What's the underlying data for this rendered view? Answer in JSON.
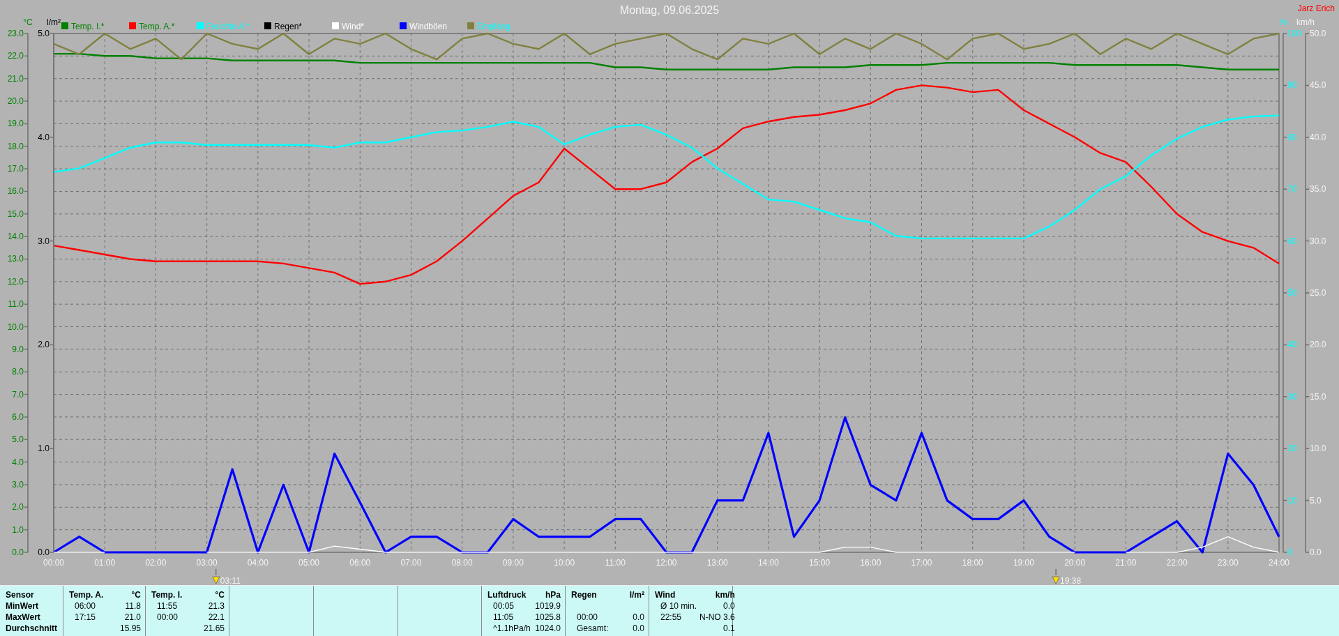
{
  "title": "Montag, 09.06.2025",
  "author": "Jarz Erich",
  "chart": {
    "axis_units": [
      "°C",
      "l/m²",
      "%",
      "km/h"
    ],
    "rain_ticks": [
      "5.0",
      "4.0",
      "3.0",
      "2.0",
      "1.0",
      "0.0"
    ],
    "chart_data": {
      "type": "line",
      "grid": true,
      "legend": true,
      "xlim": [
        0,
        24
      ],
      "ylim": [
        0,
        23
      ],
      "y2lim": [
        0,
        100
      ],
      "y3lim": [
        0,
        50
      ],
      "y2ticks": [
        {
          "value": 0,
          "label": "0"
        },
        {
          "value": 10,
          "label": "10"
        },
        {
          "value": 20,
          "label": "20"
        },
        {
          "value": 30,
          "label": "30"
        },
        {
          "value": 40,
          "label": "40"
        },
        {
          "value": 50,
          "label": "50"
        },
        {
          "value": 60,
          "label": "60"
        },
        {
          "value": 70,
          "label": "70"
        },
        {
          "value": 80,
          "label": "80"
        },
        {
          "value": 90,
          "label": "90"
        },
        {
          "value": 100,
          "label": "100"
        }
      ],
      "y3ticks": [
        {
          "value": 0,
          "label": "0.0"
        },
        {
          "value": 5,
          "label": "5.0"
        },
        {
          "value": 10,
          "label": "10.0"
        },
        {
          "value": 15,
          "label": "15.0"
        },
        {
          "value": 20,
          "label": "20.0"
        },
        {
          "value": 25,
          "label": "25.0"
        },
        {
          "value": 30,
          "label": "30.0"
        },
        {
          "value": 35,
          "label": "35.0"
        },
        {
          "value": 40,
          "label": "40.0"
        },
        {
          "value": 45,
          "label": "45.0"
        },
        {
          "value": 50,
          "label": "50.0"
        }
      ],
      "x": [
        0,
        0.5,
        1,
        1.5,
        2,
        2.5,
        3,
        3.5,
        4,
        4.5,
        5,
        5.5,
        6,
        6.5,
        7,
        7.5,
        8,
        8.5,
        9,
        9.5,
        10,
        10.5,
        11,
        11.5,
        12,
        12.5,
        13,
        13.5,
        14,
        14.5,
        15,
        15.5,
        16,
        16.5,
        17,
        17.5,
        18,
        18.5,
        19,
        19.5,
        20,
        20.5,
        21,
        21.5,
        22,
        22.5,
        23,
        23.5,
        24
      ],
      "xticks": [
        {
          "value": 0,
          "label": "00:00"
        },
        {
          "value": 1,
          "label": "01:00"
        },
        {
          "value": 2,
          "label": "02:00"
        },
        {
          "value": 3,
          "label": "03:00"
        },
        {
          "value": 4,
          "label": "04:00"
        },
        {
          "value": 5,
          "label": "05:00"
        },
        {
          "value": 6,
          "label": "06:00"
        },
        {
          "value": 7,
          "label": "07:00"
        },
        {
          "value": 8,
          "label": "08:00"
        },
        {
          "value": 9,
          "label": "09:00"
        },
        {
          "value": 10,
          "label": "10:00"
        },
        {
          "value": 11,
          "label": "11:00"
        },
        {
          "value": 12,
          "label": "12:00"
        },
        {
          "value": 13,
          "label": "13:00"
        },
        {
          "value": 14,
          "label": "14:00"
        },
        {
          "value": 15,
          "label": "15:00"
        },
        {
          "value": 16,
          "label": "16:00"
        },
        {
          "value": 17,
          "label": "17:00"
        },
        {
          "value": 18,
          "label": "18:00"
        },
        {
          "value": 19,
          "label": "19:00"
        },
        {
          "value": 20,
          "label": "20:00"
        },
        {
          "value": 21,
          "label": "21:00"
        },
        {
          "value": 22,
          "label": "22:00"
        },
        {
          "value": 23,
          "label": "23:00"
        },
        {
          "value": 24,
          "label": "24:00"
        }
      ],
      "yticks": [
        {
          "value": 0,
          "label": "0.0"
        },
        {
          "value": 1,
          "label": "1.0"
        },
        {
          "value": 2,
          "label": "2.0"
        },
        {
          "value": 3,
          "label": "3.0"
        },
        {
          "value": 4,
          "label": "4.0"
        },
        {
          "value": 5,
          "label": "5.0"
        },
        {
          "value": 6,
          "label": "6.0"
        },
        {
          "value": 7,
          "label": "7.0"
        },
        {
          "value": 8,
          "label": "8.0"
        },
        {
          "value": 9,
          "label": "9.0"
        },
        {
          "value": 10,
          "label": "10.0"
        },
        {
          "value": 11,
          "label": "11.0"
        },
        {
          "value": 12,
          "label": "12.0"
        },
        {
          "value": 13,
          "label": "13.0"
        },
        {
          "value": 14,
          "label": "14.0"
        },
        {
          "value": 15,
          "label": "15.0"
        },
        {
          "value": 16,
          "label": "16.0"
        },
        {
          "value": 17,
          "label": "17.0"
        },
        {
          "value": 18,
          "label": "18.0"
        },
        {
          "value": 19,
          "label": "19.0"
        },
        {
          "value": 20,
          "label": "20.0"
        },
        {
          "value": 21,
          "label": "21.0"
        },
        {
          "value": 22,
          "label": "22.0"
        },
        {
          "value": 23,
          "label": "23.0"
        }
      ],
      "series": [
        {
          "name": "Temp. I.*",
          "color": "#008000",
          "values": [
            22.1,
            22.1,
            22.0,
            22.0,
            21.9,
            21.9,
            21.9,
            21.8,
            21.8,
            21.8,
            21.8,
            21.8,
            21.7,
            21.7,
            21.7,
            21.7,
            21.7,
            21.7,
            21.7,
            21.7,
            21.7,
            21.7,
            21.5,
            21.5,
            21.4,
            21.4,
            21.4,
            21.4,
            21.4,
            21.5,
            21.5,
            21.5,
            21.6,
            21.6,
            21.6,
            21.7,
            21.7,
            21.7,
            21.7,
            21.7,
            21.6,
            21.6,
            21.6,
            21.6,
            21.6,
            21.5,
            21.4,
            21.4,
            21.4
          ]
        },
        {
          "name": "Temp. A.*",
          "color": "#ff0000",
          "values": [
            13.6,
            13.4,
            13.2,
            13.0,
            12.9,
            12.9,
            12.9,
            12.9,
            12.9,
            12.8,
            12.6,
            12.4,
            11.9,
            12.0,
            12.3,
            12.9,
            13.8,
            14.8,
            15.8,
            16.4,
            17.9,
            17.0,
            16.1,
            16.1,
            16.4,
            17.3,
            17.9,
            18.8,
            19.1,
            19.3,
            19.4,
            19.6,
            19.9,
            20.5,
            20.7,
            20.6,
            20.4,
            20.5,
            19.6,
            19.0,
            18.4,
            17.7,
            17.3,
            16.2,
            15.0,
            14.2,
            13.8,
            13.5,
            12.8
          ]
        },
        {
          "name": "Feuchte A.*",
          "color": "#00ffff",
          "axis": "y2",
          "values": [
            73.3,
            74,
            76,
            78,
            79,
            79,
            78.5,
            78.5,
            78.5,
            78.5,
            78.5,
            78,
            79,
            79,
            80,
            81,
            81.3,
            82,
            83,
            82,
            78.6,
            80.5,
            82,
            82.4,
            80.5,
            78,
            74,
            71,
            68,
            67.6,
            66,
            64.4,
            63.6,
            61,
            60.5,
            60.5,
            60.5,
            60.5,
            60.5,
            62.8,
            66,
            70,
            72.5,
            76.5,
            79.7,
            82,
            83.4,
            84,
            84.2
          ]
        },
        {
          "name": "Regen*",
          "color": "#000000",
          "values": [
            null,
            null,
            null,
            null,
            null,
            null,
            null,
            null,
            null,
            null,
            null,
            null,
            null,
            null,
            null,
            null,
            null,
            null,
            null,
            null,
            null,
            null,
            null,
            null,
            null,
            null,
            null,
            null,
            null,
            null,
            null,
            null,
            null,
            null,
            null,
            null,
            null,
            null,
            null,
            null,
            null,
            null,
            null,
            null,
            null,
            null,
            null,
            null,
            null
          ]
        },
        {
          "name": "Wind*",
          "color": "#ffffff",
          "axis": "y3",
          "values": [
            0,
            0,
            0,
            null,
            null,
            null,
            0,
            0,
            0,
            0,
            0,
            0.6,
            0.3,
            0,
            0,
            0,
            0,
            0,
            0,
            0,
            0,
            0,
            0,
            0,
            0,
            0,
            0,
            0,
            0,
            0,
            0,
            0.5,
            0.5,
            0,
            0,
            0,
            0,
            0,
            0,
            0,
            0,
            null,
            0,
            0,
            0,
            0.5,
            1.5,
            0.5,
            0
          ]
        },
        {
          "name": "Windböen",
          "color": "#0000ff",
          "axis": "y3",
          "values": [
            0,
            1.5,
            0,
            0,
            0,
            0,
            0,
            8,
            0,
            6.5,
            0,
            9.5,
            4.8,
            0,
            1.5,
            1.5,
            0,
            0,
            3.2,
            1.5,
            1.5,
            1.5,
            3.2,
            3.2,
            0,
            0,
            5,
            5,
            11.5,
            1.5,
            5,
            13,
            6.5,
            5,
            11.5,
            5,
            3.2,
            3.2,
            5,
            1.5,
            0,
            0,
            0,
            1.5,
            3,
            0,
            9.5,
            6.5,
            1.5
          ]
        },
        {
          "name": "Empfang",
          "color": "#808040",
          "axis": "y2",
          "values": [
            98,
            96,
            100,
            97,
            99,
            95,
            100,
            98,
            97,
            100,
            96,
            99,
            98,
            100,
            97,
            95,
            99,
            100,
            98,
            97,
            100,
            96,
            98,
            99,
            100,
            97,
            95,
            99,
            98,
            100,
            96,
            99,
            97,
            100,
            98,
            95,
            99,
            100,
            97,
            98,
            100,
            96,
            99,
            97,
            100,
            98,
            96,
            99,
            100
          ]
        }
      ],
      "annotations": [
        "03:11",
        "19:38"
      ]
    }
  },
  "table": {
    "row_labels": [
      "Sensor",
      "MinWert",
      "MaxWert",
      "Durchschnitt"
    ],
    "columns": [
      {
        "kind": "data",
        "header": "Temp. A.",
        "unit": "°C",
        "rows": [
          {
            "time": "06:00",
            "value": "11.8"
          },
          {
            "time": "17:15",
            "value": "21.0"
          },
          {
            "value": "15.95"
          }
        ]
      },
      {
        "kind": "data",
        "header": "Temp. I.",
        "unit": "°C",
        "rows": [
          {
            "time": "11:55",
            "value": "21.3"
          },
          {
            "time": "00:00",
            "value": "22.1"
          },
          {
            "value": "21.65"
          }
        ]
      },
      {
        "kind": "empty"
      },
      {
        "kind": "empty"
      },
      {
        "kind": "empty"
      },
      {
        "kind": "data",
        "header": "Luftdruck",
        "unit": "hPa",
        "rows": [
          {
            "time": "00:05",
            "value": "1019.9"
          },
          {
            "time": "11:05",
            "value": "1025.8"
          },
          {
            "time": "^1.1hPa/h",
            "value": "1024.0"
          }
        ]
      },
      {
        "kind": "data",
        "header": "Regen",
        "unit": "l/m²",
        "rows": [
          {},
          {
            "time": "00:00",
            "value": "0.0"
          },
          {
            "time": "Gesamt:",
            "value": "0.0"
          }
        ]
      },
      {
        "kind": "data",
        "header": "Wind",
        "unit": "km/h",
        "rows": [
          {
            "time": "Ø 10 min.",
            "value": "0.0"
          },
          {
            "time": "22:55",
            "value": "N-NO 3.6"
          },
          {
            "value": "0.1"
          }
        ]
      }
    ]
  }
}
